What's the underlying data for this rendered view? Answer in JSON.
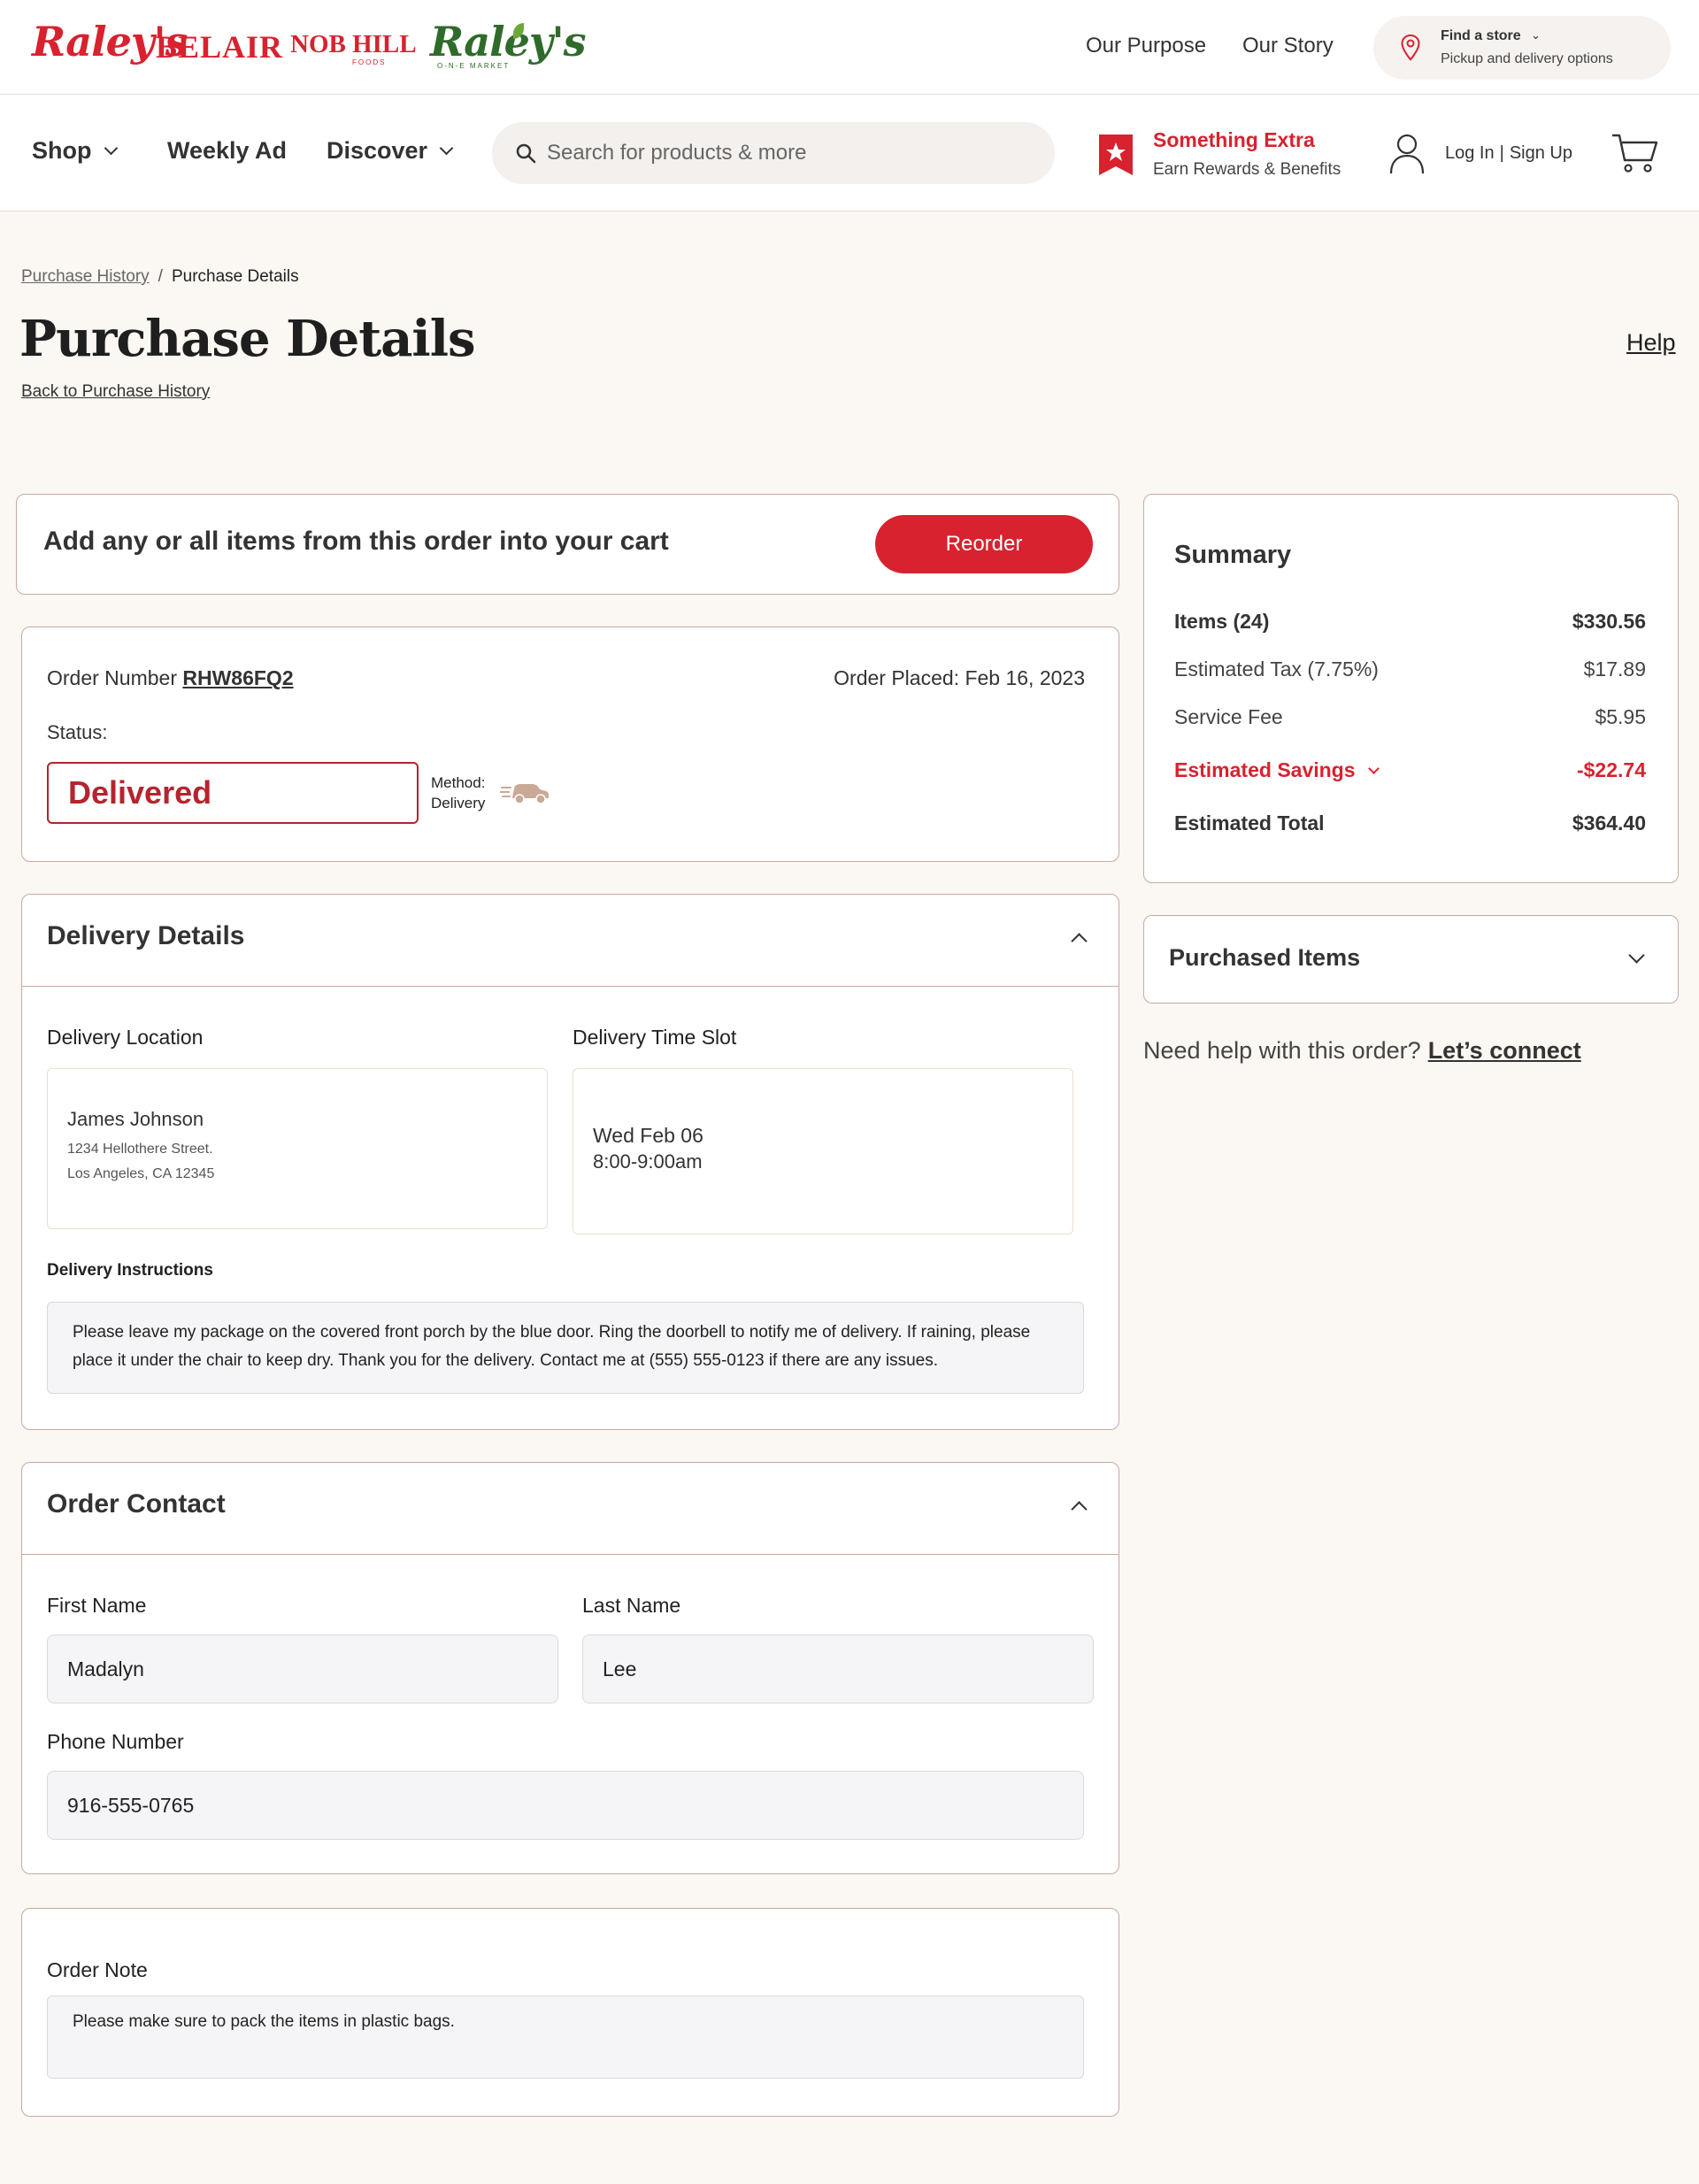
{
  "brand": {
    "logos": [
      "Raley's",
      "BELAIR",
      "NOB HILL",
      "Raley's"
    ],
    "nobhill_sub": "FOODS",
    "omarket_sub": "O-N-E MARKET"
  },
  "topbar": {
    "our_purpose": "Our Purpose",
    "our_story": "Our Story",
    "store_title": "Find a store",
    "store_sub": "Pickup and delivery options"
  },
  "nav": {
    "shop": "Shop",
    "weekly_ad": "Weekly Ad",
    "discover": "Discover",
    "search_placeholder": "Search for products & more",
    "rewards_title": "Something Extra",
    "rewards_sub": "Earn Rewards & Benefits",
    "login": "Log In",
    "divider": "|",
    "signup": "Sign Up"
  },
  "breadcrumb": {
    "parent": "Purchase History",
    "separator": "/",
    "current": "Purchase Details"
  },
  "page": {
    "title": "Purchase Details",
    "back_link": "Back to Purchase History",
    "help": "Help"
  },
  "reorder": {
    "text": "Add any or all items from this order into your cart",
    "button": "Reorder"
  },
  "order": {
    "number_label": "Order Number",
    "number": "RHW86FQ2",
    "placed": "Order Placed: Feb 16, 2023",
    "status_label": "Status:",
    "status": "Delivered",
    "method_label": "Method:",
    "method": "Delivery"
  },
  "delivery": {
    "title": "Delivery Details",
    "location_label": "Delivery Location",
    "name": "James Johnson",
    "address1": "1234 Hellothere Street.",
    "address2": "Los Angeles, CA 12345",
    "slot_label": "Delivery Time Slot",
    "slot_day": "Wed Feb 06",
    "slot_time": "8:00-9:00am",
    "instructions_label": "Delivery  Instructions",
    "instructions": "Please leave my package on the covered front porch by the blue door. Ring the doorbell to notify me of delivery. If raining, please place it under the chair to keep dry. Thank you for the delivery. Contact me at (555) 555-0123 if there are any issues."
  },
  "contact": {
    "title": "Order Contact",
    "first_name_label": "First Name",
    "first_name": "Madalyn",
    "last_name_label": "Last Name",
    "last_name": "Lee",
    "phone_label": "Phone Number",
    "phone": "916-555-0765"
  },
  "note": {
    "label": "Order Note",
    "text": "Please make sure to pack the items in plastic bags."
  },
  "summary": {
    "title": "Summary",
    "items_label": "Items (24)",
    "items_value": "$330.56",
    "tax_label": "Estimated Tax (7.75%)",
    "tax_value": "$17.89",
    "fee_label": "Service Fee",
    "fee_value": "$5.95",
    "savings_label": "Estimated Savings",
    "savings_value": "-$22.74",
    "total_label": "Estimated Total",
    "total_value": "$364.40"
  },
  "purchased": {
    "title": "Purchased Items"
  },
  "helpline": {
    "text": "Need help with this order?",
    "link": "Let’s connect"
  },
  "colors": {
    "brand_red": "#d8222f",
    "status_red": "#b3252e",
    "page_bg": "#fbf7f3",
    "card_border": "#c9a9a1"
  }
}
